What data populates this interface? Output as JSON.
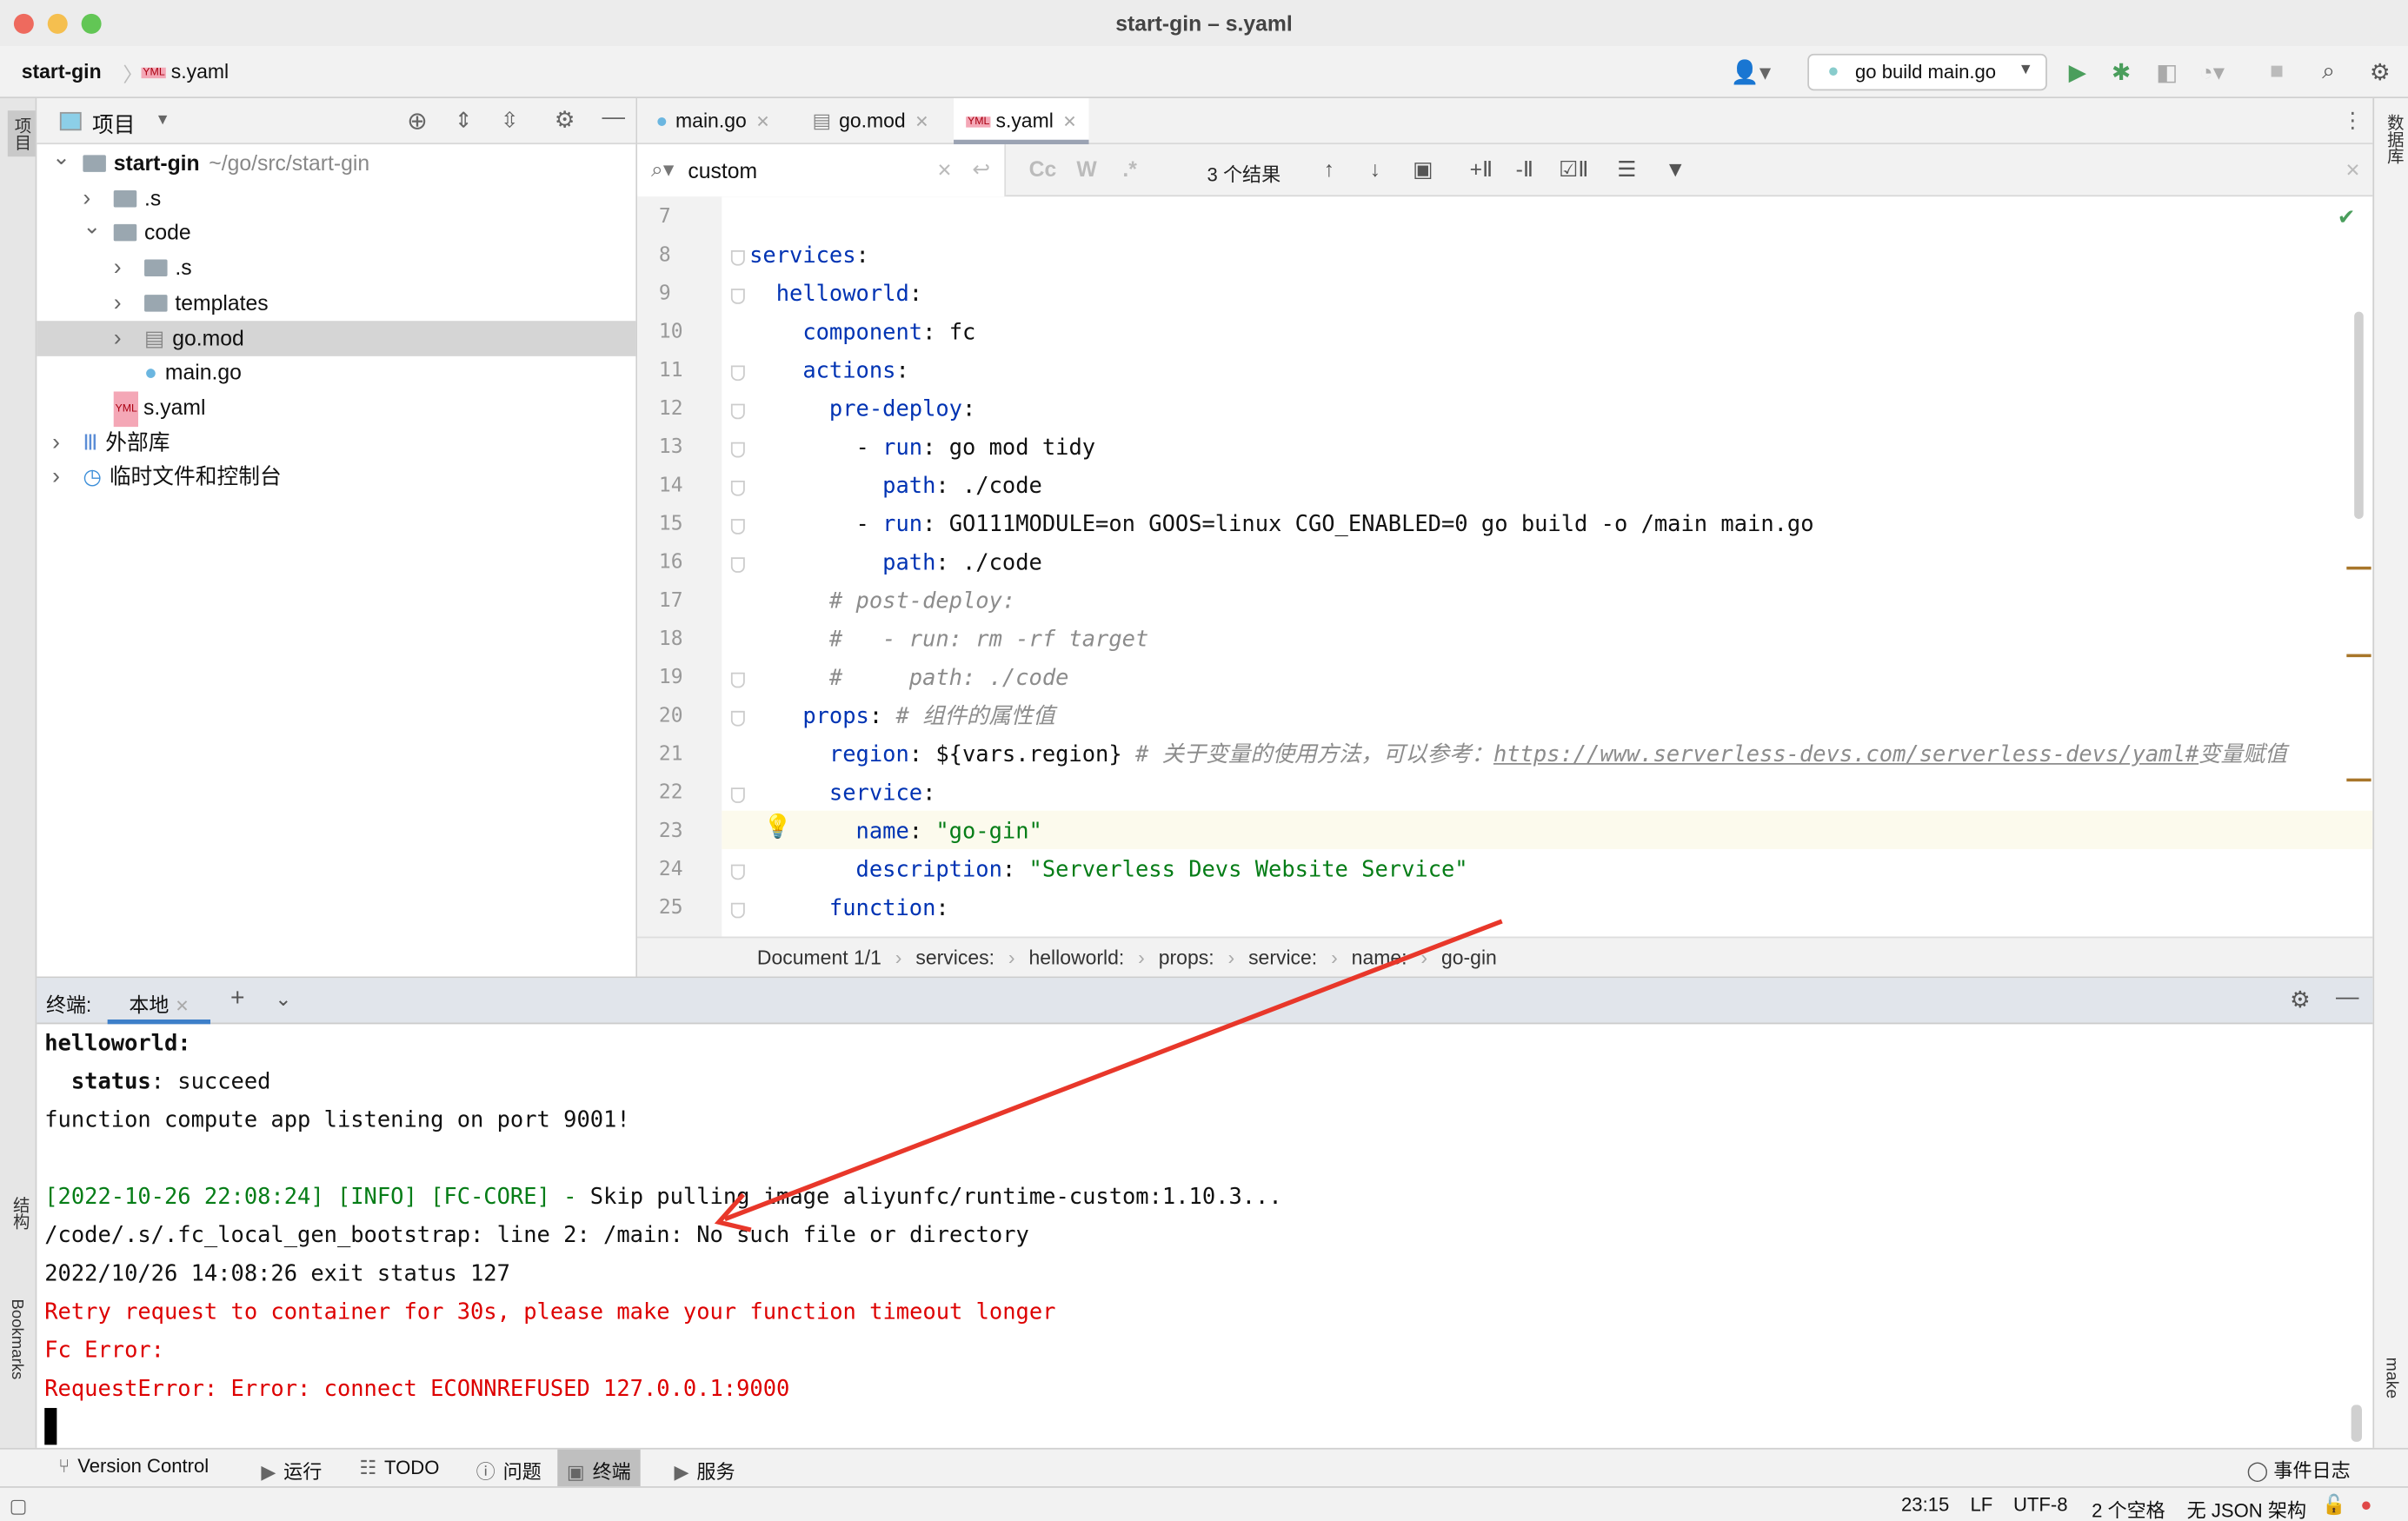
{
  "window": {
    "title": "start-gin – s.yaml"
  },
  "navbar": {
    "project": "start-gin",
    "file": "s.yaml",
    "file_badge": "YML",
    "run_config": "go build main.go"
  },
  "left_strip": {
    "project": "项目",
    "structure": "结构",
    "bookmarks": "Bookmarks"
  },
  "right_strip": {
    "database": "数据库",
    "make": "make"
  },
  "project_panel": {
    "title": "项目",
    "tree": [
      {
        "label": "start-gin",
        "path": "~/go/src/start-gin",
        "type": "folder",
        "expanded": true
      },
      {
        "label": ".s",
        "type": "folder"
      },
      {
        "label": "code",
        "type": "folder",
        "expanded": true
      },
      {
        "label": ".s",
        "type": "folder"
      },
      {
        "label": "templates",
        "type": "folder"
      },
      {
        "label": "go.mod",
        "type": "file",
        "selected": true
      },
      {
        "label": "main.go",
        "type": "go-file"
      },
      {
        "label": "s.yaml",
        "type": "yaml-file"
      },
      {
        "label": "外部库",
        "type": "library"
      },
      {
        "label": "临时文件和控制台",
        "type": "scratch"
      }
    ]
  },
  "editor": {
    "tabs": [
      {
        "label": "main.go"
      },
      {
        "label": "go.mod"
      },
      {
        "label": "s.yaml",
        "active": true
      }
    ],
    "search": {
      "value": "custom",
      "flags": [
        "Cc",
        "W",
        ".*"
      ],
      "result_count": "3 个结果"
    },
    "lines": [
      {
        "n": "7",
        "html": ""
      },
      {
        "n": "8",
        "html": "<span class='k'>services</span>:"
      },
      {
        "n": "9",
        "html": "  <span class='k'>helloworld</span>:"
      },
      {
        "n": "10",
        "html": "    <span class='k'>component</span>: fc"
      },
      {
        "n": "11",
        "html": "    <span class='k'>actions</span>:"
      },
      {
        "n": "12",
        "html": "      <span class='k'>pre-deploy</span>:"
      },
      {
        "n": "13",
        "html": "        - <span class='k'>run</span>: go mod tidy"
      },
      {
        "n": "14",
        "html": "          <span class='k'>path</span>: ./code"
      },
      {
        "n": "15",
        "html": "        - <span class='k'>run</span>: GO111MODULE=on GOOS=linux CGO_ENABLED=0 go build -o /main main.go"
      },
      {
        "n": "16",
        "html": "          <span class='k'>path</span>: ./code"
      },
      {
        "n": "17",
        "html": "      <span class='c'># post-deploy:</span>"
      },
      {
        "n": "18",
        "html": "      <span class='c'>#   - run: rm -rf target</span>"
      },
      {
        "n": "19",
        "html": "      <span class='c'>#     path: ./code</span>"
      },
      {
        "n": "20",
        "html": "    <span class='k'>props</span>: <span class='c'># 组件的属性值</span>"
      },
      {
        "n": "21",
        "html": "      <span class='k'>region</span>: ${vars.region} <span class='c'># 关于变量的使用方法，可以参考：<span class='u'>https://www.serverless-devs.com/serverless-devs/yaml#</span>变量赋值</span>"
      },
      {
        "n": "22",
        "html": "      <span class='k'>service</span>:"
      },
      {
        "n": "23",
        "html": "        <span class='k'>name</span>: <span class='s'>\"go-gin\"</span>"
      },
      {
        "n": "24",
        "html": "        <span class='k'>description</span>: <span class='s'>\"Serverless Devs Website Service\"</span>"
      },
      {
        "n": "25",
        "html": "      <span class='k'>function</span>:"
      }
    ],
    "breadcrumbs": [
      "Document 1/1",
      "services:",
      "helloworld:",
      "props:",
      "service:",
      "name:",
      "go-gin"
    ]
  },
  "terminal": {
    "label": "终端:",
    "tab": "本地",
    "lines": [
      {
        "cls": "b",
        "text": "helloworld:"
      },
      {
        "cls": "",
        "html": "  <b>status</b>: succeed"
      },
      {
        "cls": "",
        "text": "function compute app listening on port 9001!"
      },
      {
        "cls": "",
        "text": ""
      },
      {
        "cls": "",
        "html": "<span class='g'>[2022-10-26 22:08:24] [INFO] [FC-CORE] - </span>Skip pulling image aliyunfc/runtime-custom:1.10.3..."
      },
      {
        "cls": "",
        "text": "/code/.s/.fc_local_gen_bootstrap: line 2: /main: No such file or directory"
      },
      {
        "cls": "",
        "text": "2022/10/26 14:08:26 exit status 127"
      },
      {
        "cls": "r",
        "text": "Retry request to container for 30s, please make your function timeout longer"
      },
      {
        "cls": "r",
        "text": "Fc Error:"
      },
      {
        "cls": "r",
        "text": "RequestError: Error: connect ECONNREFUSED 127.0.0.1:9000"
      }
    ]
  },
  "toolwindows": {
    "items": [
      "Version Control",
      "运行",
      "TODO",
      "问题",
      "终端",
      "服务"
    ],
    "event_log": "事件日志"
  },
  "status": {
    "position": "23:15",
    "line_sep": "LF",
    "encoding": "UTF-8",
    "indent": "2 个空格",
    "schema": "无 JSON 架构"
  },
  "colors": {
    "keyword": "#0033b3",
    "string": "#067d17",
    "comment": "#8c8c8c",
    "error": "#dd0000",
    "annotation_arrow": "#e8372a"
  }
}
